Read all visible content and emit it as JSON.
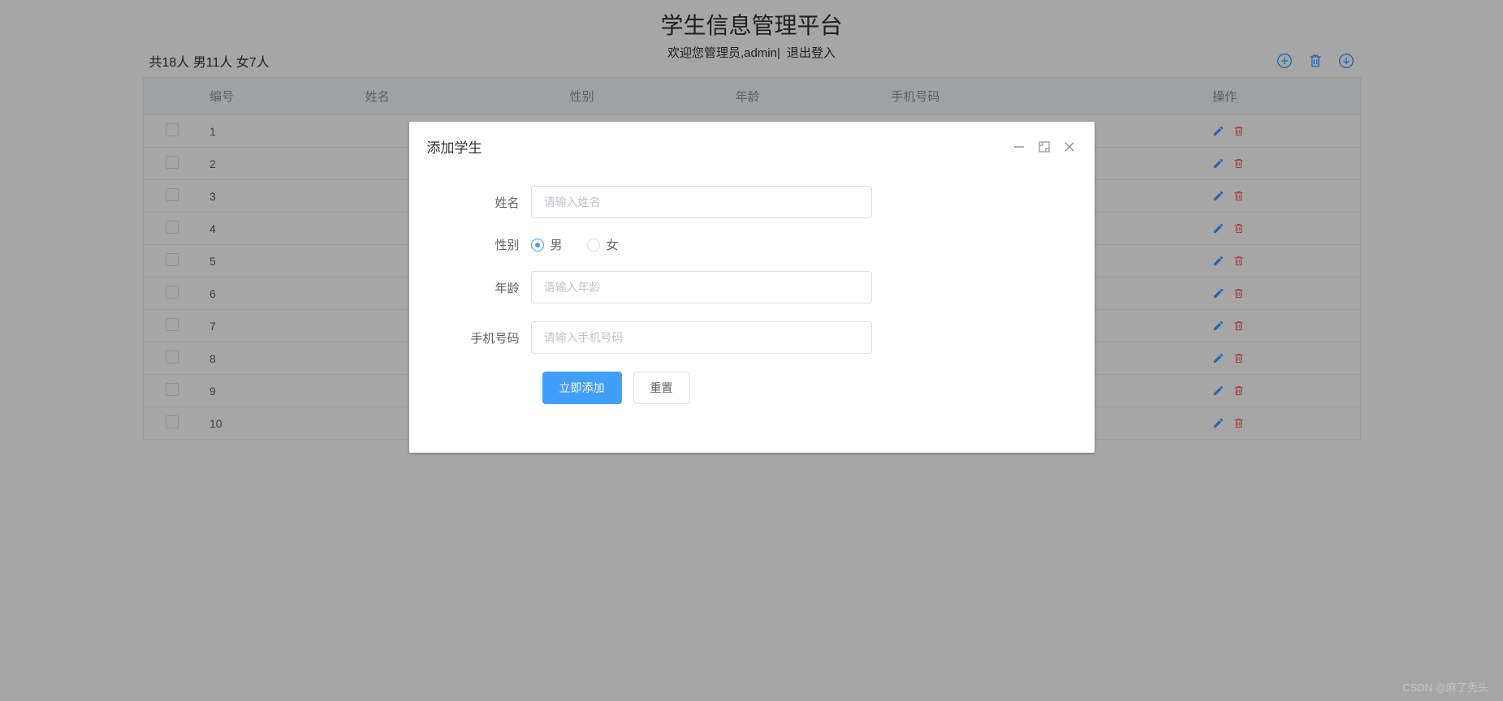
{
  "header": {
    "title": "学生信息管理平台",
    "welcome_prefix": "欢迎您管理员,",
    "username": "admin",
    "separator": "|",
    "logout": "退出登入"
  },
  "stats": "共18人 男11人 女7人",
  "toolbar": {
    "add_icon": "add-circle-icon",
    "delete_icon": "trash-icon",
    "download_icon": "download-circle-icon"
  },
  "columns": {
    "id": "编号",
    "name": "姓名",
    "gender": "性别",
    "age": "年龄",
    "phone": "手机号码",
    "op": "操作"
  },
  "rows": [
    {
      "id": "1"
    },
    {
      "id": "2"
    },
    {
      "id": "3"
    },
    {
      "id": "4"
    },
    {
      "id": "5"
    },
    {
      "id": "6"
    },
    {
      "id": "7"
    },
    {
      "id": "8"
    },
    {
      "id": "9"
    },
    {
      "id": "10"
    }
  ],
  "dialog": {
    "title": "添加学生",
    "fields": {
      "name_label": "姓名",
      "name_placeholder": "请输入姓名",
      "gender_label": "性别",
      "gender_male": "男",
      "gender_female": "女",
      "age_label": "年龄",
      "age_placeholder": "请输入年龄",
      "phone_label": "手机号码",
      "phone_placeholder": "请输入手机号码"
    },
    "buttons": {
      "submit": "立即添加",
      "reset": "重置"
    }
  },
  "watermark": "CSDN @麻了秃头"
}
